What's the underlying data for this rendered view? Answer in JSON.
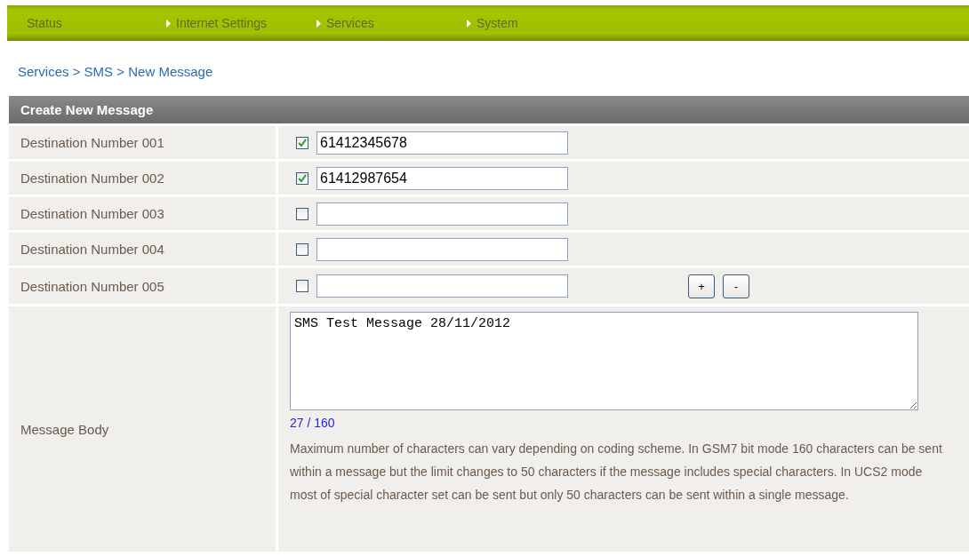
{
  "nav": [
    {
      "label": "Status",
      "arrow": false
    },
    {
      "label": "Internet Settings",
      "arrow": true
    },
    {
      "label": "Services",
      "arrow": true
    },
    {
      "label": "System",
      "arrow": true
    }
  ],
  "breadcrumb": "Services > SMS > New Message",
  "section": {
    "title": "Create New Message"
  },
  "destinations": [
    {
      "label": "Destination Number 001",
      "checked": true,
      "value": "61412345678"
    },
    {
      "label": "Destination Number 002",
      "checked": true,
      "value": "61412987654"
    },
    {
      "label": "Destination Number 003",
      "checked": false
    },
    {
      "label": "Destination Number 004",
      "checked": false
    },
    {
      "label": "Destination Number 005",
      "checked": false
    }
  ],
  "row_buttons": [
    "+",
    "-"
  ],
  "message": {
    "label": "Message Body",
    "value": "SMS Test Message 28/11/2012",
    "counter": "27 / 160",
    "note": "Maximum number of characters can vary depending on coding scheme. In GSM7 bit mode 160 characters can be sent within a message but the limit changes to 50 characters if the message includes special characters. In UCS2 mode most of special character set can be sent but only 50 characters can be sent within a single message."
  }
}
